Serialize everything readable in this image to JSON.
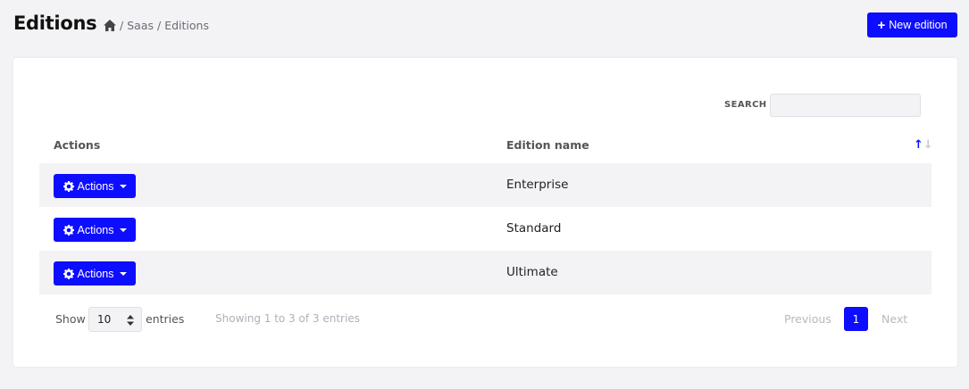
{
  "header": {
    "title": "Editions",
    "breadcrumb": [
      {
        "label": "Saas"
      },
      {
        "label": "Editions"
      }
    ],
    "new_button_label": "New edition"
  },
  "table": {
    "search_label": "SEARCH",
    "search_value": "",
    "columns": [
      "Actions",
      "Edition name"
    ],
    "rows": [
      {
        "actions_label": "Actions",
        "name": "Enterprise"
      },
      {
        "actions_label": "Actions",
        "name": "Standard"
      },
      {
        "actions_label": "Actions",
        "name": "Ultimate"
      }
    ]
  },
  "footer": {
    "show_label": "Show",
    "page_length": "10",
    "entries_label": "entries",
    "info": "Showing 1 to 3 of 3 entries",
    "previous_label": "Previous",
    "current_page": "1",
    "next_label": "Next"
  },
  "colors": {
    "primary": "#0d0dff",
    "background": "#f3f3f6",
    "stripe": "#f3f3f5"
  },
  "icons": {
    "home": "home-icon",
    "plus": "plus-icon",
    "gear": "gear-icon",
    "caret": "caret-down-icon",
    "sort": "sort-icon"
  }
}
